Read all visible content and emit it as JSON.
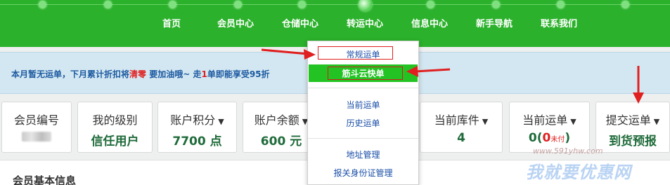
{
  "nav": {
    "items": [
      "首页",
      "会员中心",
      "仓储中心",
      "转运中心",
      "信息中心",
      "新手导航",
      "联系我们"
    ],
    "active_index": 3
  },
  "notice": {
    "part1": "本月暂无运单，下月累计折扣将",
    "highlight1": "清零",
    "part2": " 要加油哦~ 走",
    "highlight2": "1",
    "part3": "单即能享受95折"
  },
  "cards": [
    {
      "label": "会员编号",
      "value": ""
    },
    {
      "label": "我的级别",
      "value": "信任用户"
    },
    {
      "label": "账户积分",
      "value": "7700 点"
    },
    {
      "label": "账户余额",
      "value": "600 元"
    },
    {
      "label": "当前库件",
      "value": "4"
    },
    {
      "label": "当前运单",
      "value_main": "0",
      "value_paren_open": "(",
      "value_red": "0",
      "value_sub": "未付",
      "value_paren_close": ")"
    },
    {
      "label": "提交运单",
      "value": "到货预报"
    }
  ],
  "panel": {
    "title": "会员基本信息"
  },
  "dropdown": {
    "item1": "常规运单",
    "item2": "筋斗云快单",
    "item3": "当前运单",
    "item4": "历史运单",
    "item5": "地址管理",
    "item6": "报关身份证管理"
  },
  "caret": "▼",
  "watermark": {
    "url": "www.591yhw.com",
    "text": "我就要优惠网"
  },
  "colors": {
    "nav_bg": "#2bb12b",
    "highlight_bg": "#22c322",
    "annotation_red": "#e02020",
    "link_blue": "#1b4fa8"
  }
}
